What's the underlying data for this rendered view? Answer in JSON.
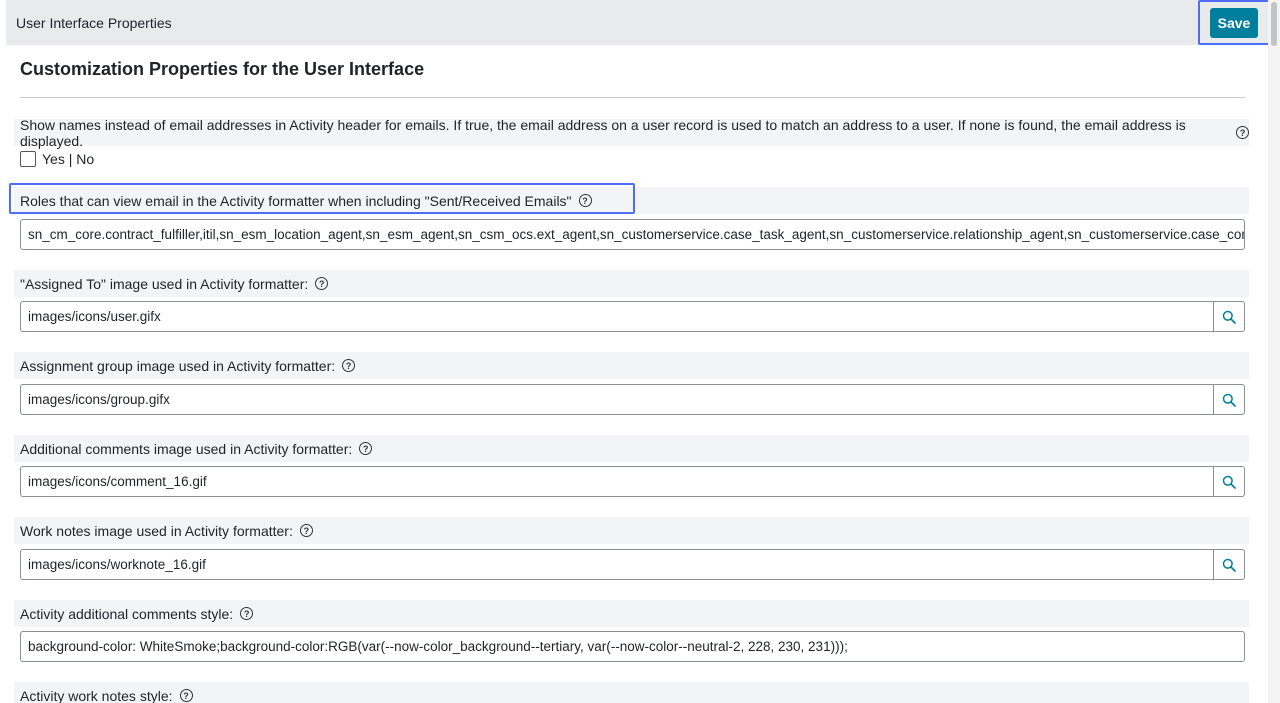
{
  "header": {
    "title": "User Interface Properties",
    "save_label": "Save"
  },
  "page": {
    "title": "Customization Properties for the User Interface"
  },
  "properties": [
    {
      "label": "Show names instead of email addresses in Activity header for emails. If true, the email address on a user record is used to match an address to a user. If none is found, the email address is displayed.",
      "type": "checkbox",
      "checked": false,
      "option_text": "Yes | No"
    },
    {
      "label": "Roles that can view email in the Activity formatter when including \"Sent/Received Emails\"",
      "type": "text",
      "value": "sn_cm_core.contract_fulfiller,itil,sn_esm_location_agent,sn_esm_agent,sn_csm_ocs.ext_agent,sn_customerservice.case_task_agent,sn_customerservice.relationship_agent,sn_customerservice.case_cont"
    },
    {
      "label": "\"Assigned To\" image used in Activity formatter:",
      "type": "reference",
      "value": "images/icons/user.gifx"
    },
    {
      "label": "Assignment group image used in Activity formatter:",
      "type": "reference",
      "value": "images/icons/group.gifx"
    },
    {
      "label": "Additional comments image used in Activity formatter:",
      "type": "reference",
      "value": "images/icons/comment_16.gif"
    },
    {
      "label": "Work notes image used in Activity formatter:",
      "type": "reference",
      "value": "images/icons/worknote_16.gif"
    },
    {
      "label": "Activity additional comments style:",
      "type": "text",
      "value": "background-color: WhiteSmoke;background-color:RGB(var(--now-color_background--tertiary, var(--now-color--neutral-2, 228, 230, 231)));"
    },
    {
      "label": "Activity work notes style:",
      "type": "text",
      "value": ""
    }
  ],
  "icons": {
    "help": "question-circle-icon",
    "lookup": "magnifier-icon"
  },
  "colors": {
    "accent": "#007e9e",
    "highlight_border": "#4f6ef7",
    "header_bg": "#e8eaec",
    "label_row_bg": "#f3f4f5"
  }
}
